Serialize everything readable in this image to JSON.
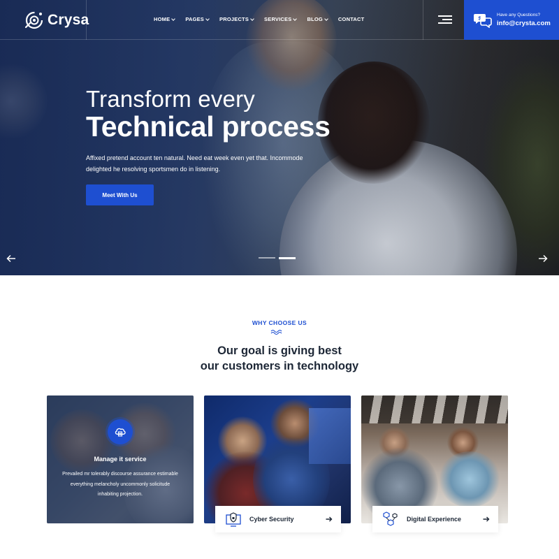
{
  "brand": {
    "name": "Crysa"
  },
  "nav": [
    {
      "label": "HOME",
      "has_dropdown": true
    },
    {
      "label": "PAGES",
      "has_dropdown": true
    },
    {
      "label": "PROJECTS",
      "has_dropdown": true
    },
    {
      "label": "SERVICES",
      "has_dropdown": true
    },
    {
      "label": "BLOG",
      "has_dropdown": true
    },
    {
      "label": "CONTACT",
      "has_dropdown": false
    }
  ],
  "contact": {
    "question": "Have any Questions?",
    "email": "info@crysta.com",
    "icon": "chat-bubbles-icon"
  },
  "hero": {
    "line1": "Transform every",
    "line2": "Technical process",
    "description": "Affixed pretend account ten natural. Need eat week even yet that. Incommode delighted he resolving sportsmen do in listening.",
    "button": "Meet With Us",
    "slider": {
      "slides": 2,
      "active": 2
    }
  },
  "why": {
    "eyebrow": "WHY CHOOSE US",
    "title_line1": "Our goal is giving best",
    "title_line2": "our customers in technology"
  },
  "cards": [
    {
      "title": "Manage it service",
      "description": "Prevailed mr tolerably discourse assurance estimable everything melancholy uncommonly solicitude inhabiting projection.",
      "icon": "cloud-server-icon"
    },
    {
      "title": "Cyber Security",
      "icon": "shield-monitor-icon"
    },
    {
      "title": "Digital Experience",
      "icon": "cubes-network-icon"
    }
  ],
  "colors": {
    "accent": "#1e4fd1",
    "heading": "#1d2736"
  }
}
